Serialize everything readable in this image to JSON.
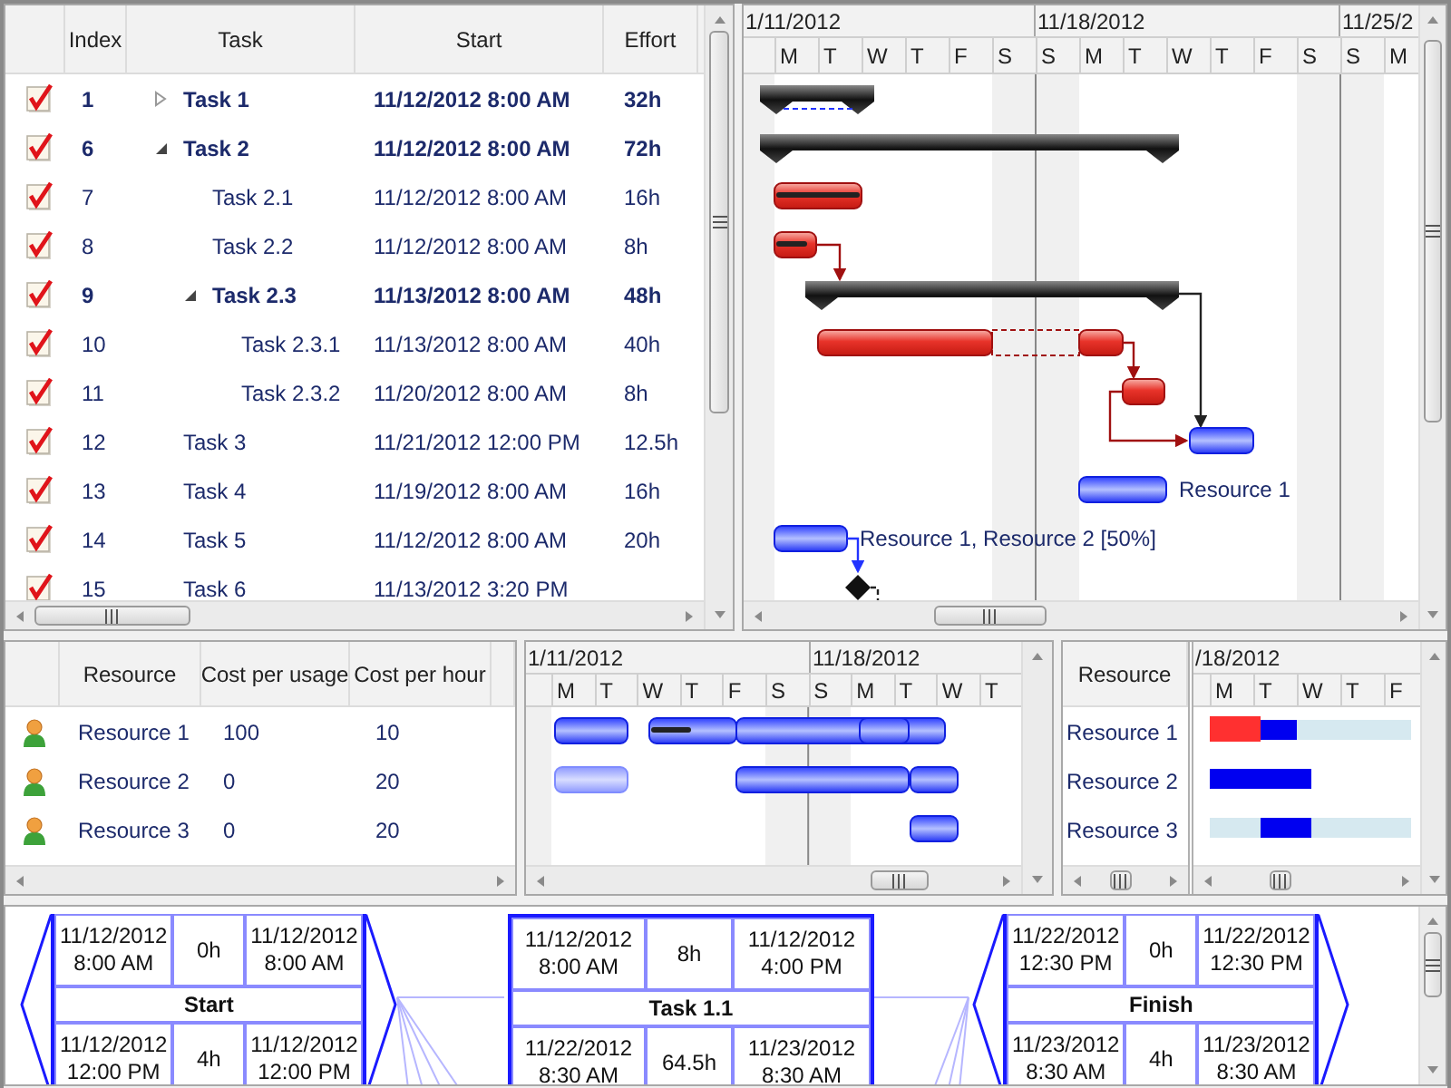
{
  "task_grid": {
    "columns": [
      "Index",
      "Task",
      "Start",
      "Effort"
    ],
    "rows": [
      {
        "index": "1",
        "name": "Task 1",
        "start": "11/12/2012 8:00 AM",
        "effort": "32h",
        "kind": "summary",
        "checked": true,
        "expanded": false
      },
      {
        "index": "6",
        "name": "Task 2",
        "start": "11/12/2012 8:00 AM",
        "effort": "72h",
        "kind": "summary",
        "checked": true,
        "expanded": true,
        "children": [
          {
            "index": "7",
            "name": "Task 2.1",
            "start": "11/12/2012 8:00 AM",
            "effort": "16h",
            "kind": "task",
            "checked": true
          },
          {
            "index": "8",
            "name": "Task 2.2",
            "start": "11/12/2012 8:00 AM",
            "effort": "8h",
            "kind": "task",
            "checked": true
          },
          {
            "index": "9",
            "name": "Task 2.3",
            "start": "11/13/2012 8:00 AM",
            "effort": "48h",
            "kind": "summary",
            "checked": true,
            "expanded": true,
            "children": [
              {
                "index": "10",
                "name": "Task 2.3.1",
                "start": "11/13/2012 8:00 AM",
                "effort": "40h",
                "kind": "task",
                "checked": true
              },
              {
                "index": "11",
                "name": "Task 2.3.2",
                "start": "11/20/2012 8:00 AM",
                "effort": "8h",
                "kind": "task",
                "checked": true
              }
            ]
          }
        ]
      },
      {
        "index": "12",
        "name": "Task 3",
        "start": "11/21/2012 12:00 PM",
        "effort": "12.5h",
        "kind": "task",
        "checked": true
      },
      {
        "index": "13",
        "name": "Task 4",
        "start": "11/19/2012 8:00 AM",
        "effort": "16h",
        "kind": "task",
        "checked": true
      },
      {
        "index": "14",
        "name": "Task 5",
        "start": "11/12/2012 8:00 AM",
        "effort": "20h",
        "kind": "task",
        "checked": true
      },
      {
        "index": "15",
        "name": "Task 6",
        "start": "11/13/2012 3:20 PM",
        "kind": "task",
        "checked": true
      }
    ]
  },
  "task_gantt": {
    "weeks": [
      "1/11/2012",
      "11/18/2012",
      "11/25/2"
    ],
    "days": [
      "M",
      "T",
      "W",
      "T",
      "F",
      "S",
      "S",
      "M",
      "T",
      "W",
      "T",
      "F",
      "S",
      "S",
      "M"
    ],
    "bar_labels": [
      "Resource 1",
      "Resource 1, Resource 2 [50%]"
    ]
  },
  "resource_grid": {
    "columns": [
      "Resource",
      "Cost per usage",
      "Cost per hour"
    ],
    "rows": [
      {
        "name": "Resource 1",
        "cost_per_usage": "100",
        "cost_per_hour": "10"
      },
      {
        "name": "Resource 2",
        "cost_per_usage": "0",
        "cost_per_hour": "20"
      },
      {
        "name": "Resource 3",
        "cost_per_usage": "0",
        "cost_per_hour": "20"
      }
    ]
  },
  "resource_gantt": {
    "weeks": [
      "1/11/2012",
      "11/18/2012"
    ],
    "days": [
      "M",
      "T",
      "W",
      "T",
      "F",
      "S",
      "S",
      "M",
      "T",
      "W",
      "T"
    ]
  },
  "load_view": {
    "column": "Resource",
    "week": "/18/2012",
    "days": [
      "M",
      "T",
      "W",
      "T",
      "F"
    ],
    "rows": [
      "Resource 1",
      "Resource 2",
      "Resource 3"
    ]
  },
  "network": {
    "nodes": [
      {
        "kind": "milestone",
        "name": "Start",
        "top": [
          "11/12/2012 8:00 AM",
          "0h",
          "11/12/2012 8:00 AM"
        ],
        "bottom": [
          "11/12/2012 12:00 PM",
          "4h",
          "11/12/2012 12:00 PM"
        ]
      },
      {
        "kind": "task",
        "name": "Task 1.1",
        "top": [
          "11/12/2012 8:00 AM",
          "8h",
          "11/12/2012 4:00 PM"
        ],
        "bottom": [
          "11/22/2012 8:30 AM",
          "64.5h",
          "11/23/2012 8:30 AM"
        ]
      },
      {
        "kind": "milestone",
        "name": "Finish",
        "top": [
          "11/22/2012 12:30 PM",
          "0h",
          "11/22/2012 12:30 PM"
        ],
        "bottom": [
          "11/23/2012 8:30 AM",
          "4h",
          "11/23/2012 8:30 AM"
        ]
      }
    ]
  }
}
